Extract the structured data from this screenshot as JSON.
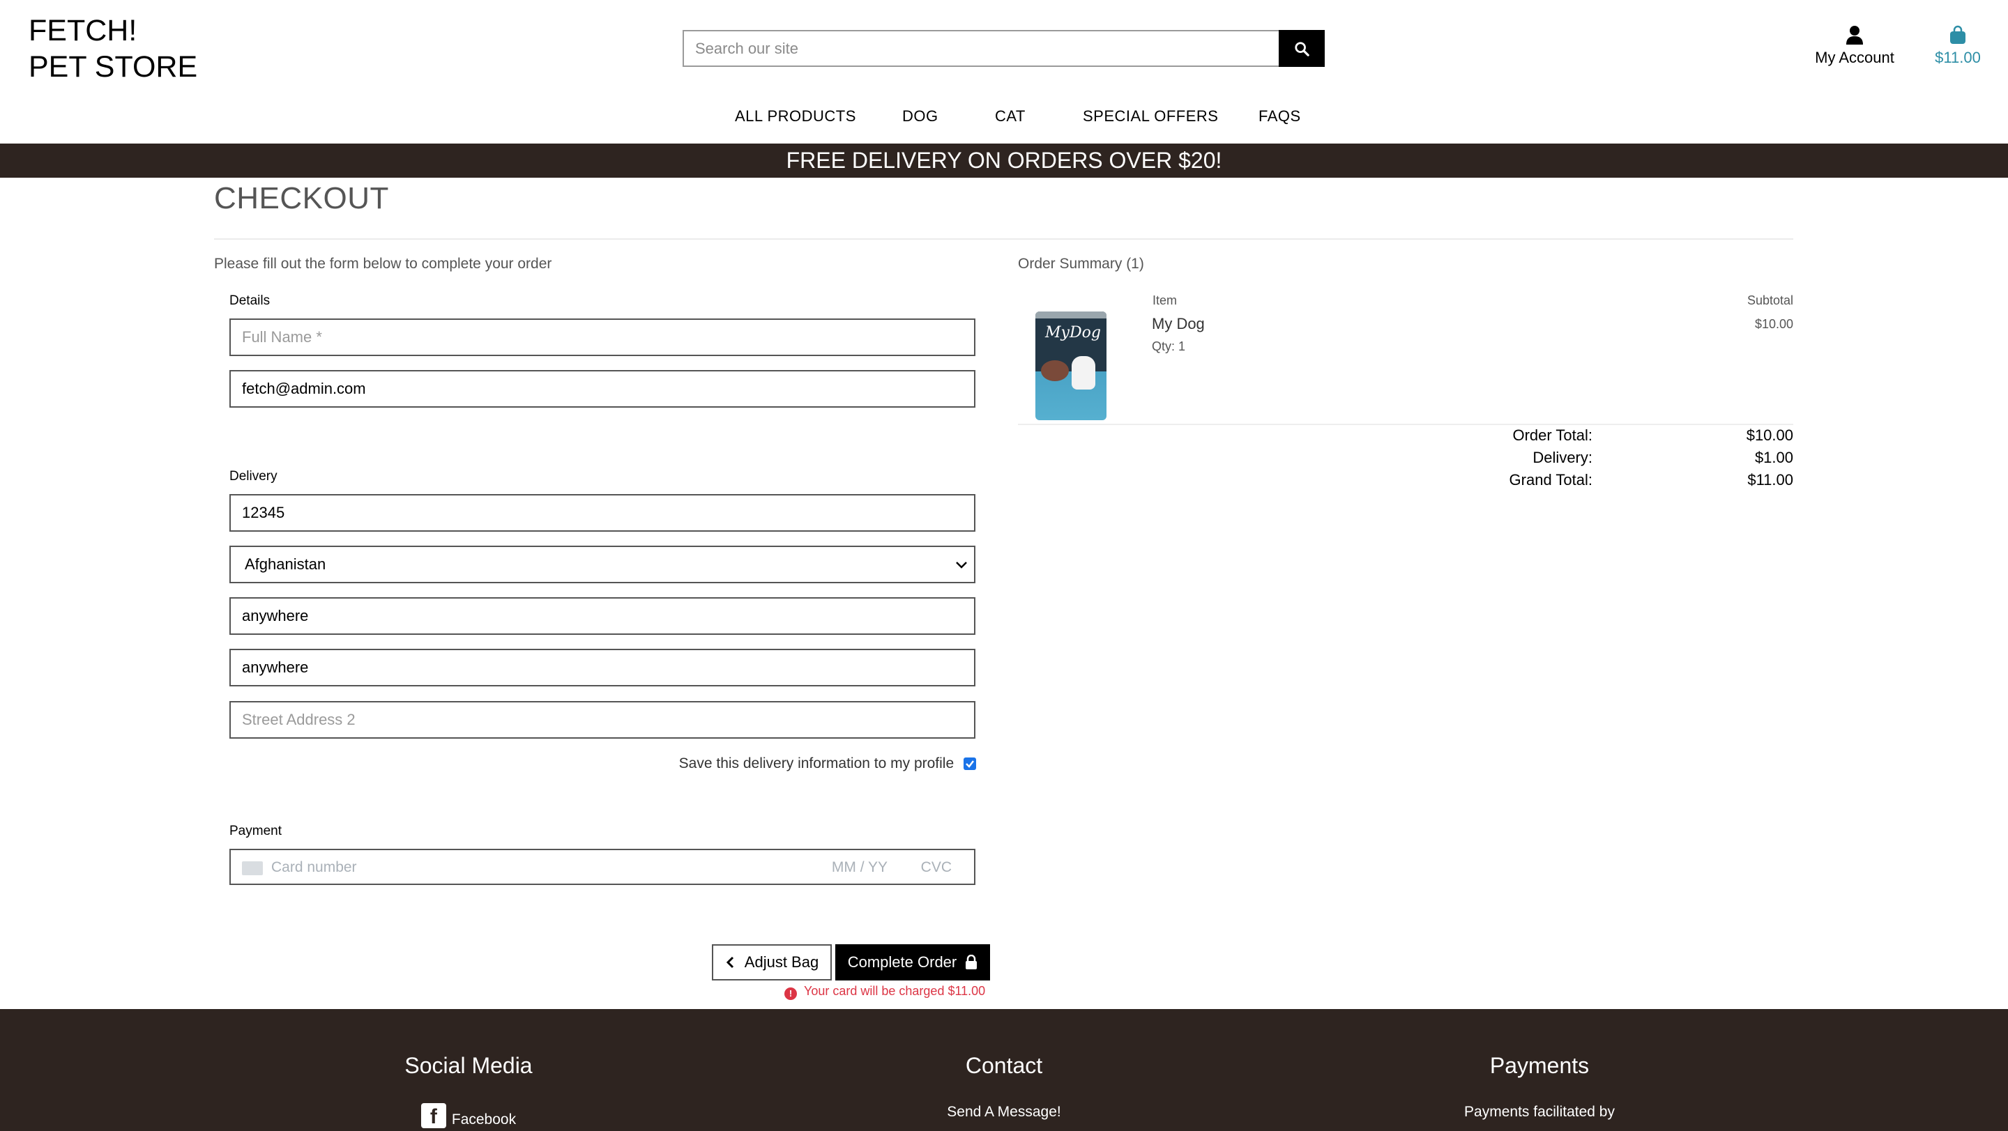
{
  "header": {
    "logo_line1": "FETCH!",
    "logo_line2": "PET STORE",
    "search_placeholder": "Search our site",
    "account_label": "My Account",
    "bag_total": "$11.00",
    "accent_color": "#2d8ea6"
  },
  "nav": {
    "items": [
      "ALL PRODUCTS",
      "DOG",
      "CAT",
      "SPECIAL OFFERS",
      "FAQS"
    ]
  },
  "banner": {
    "text": "FREE DELIVERY ON ORDERS OVER $20!",
    "color": "#2e2420"
  },
  "checkout": {
    "title": "CHECKOUT",
    "intro": "Please fill out the form below to complete your order",
    "details_label": "Details",
    "full_name_placeholder": "Full Name *",
    "email_value": "fetch@admin.com",
    "delivery_label": "Delivery",
    "postcode_value": "12345",
    "country_value": "Afghanistan",
    "town_value": "anywhere",
    "street1_value": "anywhere",
    "street2_placeholder": "Street Address 2",
    "save_info_label": "Save this delivery information to my profile",
    "save_info_checked": true,
    "payment_label": "Payment",
    "card_number_placeholder": "Card number",
    "card_expiry_placeholder": "MM / YY",
    "card_cvc_placeholder": "CVC",
    "adjust_bag_label": "Adjust Bag",
    "complete_order_label": "Complete Order",
    "charge_notice": "Your card will be charged $11.00",
    "warning_color": "#dc3545"
  },
  "summary": {
    "title": "Order Summary (1)",
    "col_item": "Item",
    "col_subtotal": "Subtotal",
    "product_name": "My Dog",
    "product_qty": "Qty: 1",
    "product_subtotal": "$10.00",
    "product_image_brand": "MyDog",
    "order_total_label": "Order Total:",
    "order_total_value": "$10.00",
    "delivery_label": "Delivery:",
    "delivery_value": "$1.00",
    "grand_total_label": "Grand Total:",
    "grand_total_value": "$11.00"
  },
  "footer": {
    "social_title": "Social Media",
    "facebook_label": "Facebook",
    "contact_title": "Contact",
    "contact_link": "Send A Message!",
    "payments_title": "Payments",
    "payments_text": "Payments facilitated by"
  }
}
